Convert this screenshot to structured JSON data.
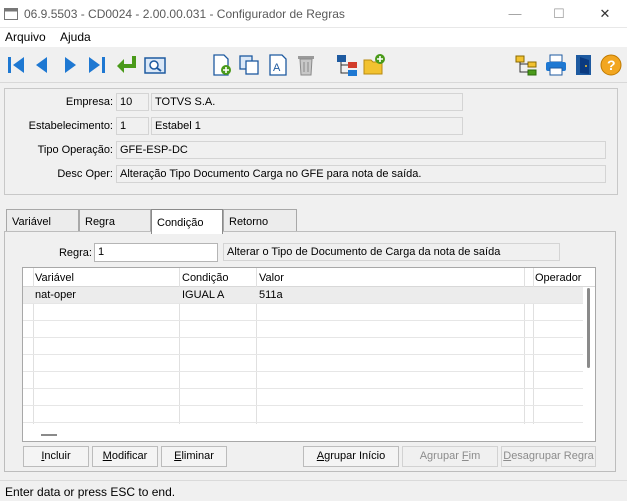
{
  "window": {
    "title": "06.9.5503 - CD0024 - 2.00.00.031 - Configurador de Regras",
    "controls": {
      "minimize": "—",
      "maximize": "☐",
      "close": "✕"
    }
  },
  "menu": [
    {
      "label": "Arquivo"
    },
    {
      "label": "Ajuda"
    }
  ],
  "toolbar": {
    "buttons": [
      "first-icon",
      "previous-icon",
      "next-icon",
      "last-icon",
      "goto-icon",
      "search-icon",
      "new-icon",
      "copy-icon",
      "edit-icon",
      "delete-icon",
      "tree-icon",
      "folder-new-icon",
      "hierarchy-icon",
      "print-icon",
      "exit-icon",
      "help-icon"
    ]
  },
  "header": {
    "empresa": {
      "label": "Empresa:",
      "code": "10",
      "name": "TOTVS S.A."
    },
    "estabelecimento": {
      "label": "Estabelecimento:",
      "code": "1",
      "name": "Estabel 1"
    },
    "tipo_operacao": {
      "label": "Tipo Operação:",
      "value": "GFE-ESP-DC"
    },
    "desc_oper": {
      "label": "Desc Oper:",
      "value": "Alteração Tipo Documento Carga no GFE para nota de saída."
    }
  },
  "tabs": [
    {
      "label": "Variável",
      "active": false
    },
    {
      "label": "Regra",
      "active": false
    },
    {
      "label": "Condição",
      "active": true
    },
    {
      "label": "Retorno",
      "active": false
    }
  ],
  "regra": {
    "label": "Regra:",
    "value": "1",
    "description": "Alterar o Tipo de Documento de Carga da nota de saída"
  },
  "grid": {
    "columns": [
      "Variável",
      "Condição",
      "Valor",
      "Operador"
    ],
    "rows": [
      {
        "variavel": "nat-oper",
        "condicao": "IGUAL A",
        "valor": "511a",
        "operador": ""
      }
    ]
  },
  "buttons": {
    "incluir": {
      "label": "Incluir",
      "underline": "I",
      "rest": "ncluir"
    },
    "modificar": {
      "label": "Modificar",
      "underline": "M",
      "rest": "odificar"
    },
    "eliminar": {
      "label": "Eliminar",
      "underline": "E",
      "rest": "liminar"
    },
    "agrupar_inicio": {
      "label": "Agrupar Início",
      "pre": "",
      "underline": "A",
      "rest": "grupar Início"
    },
    "agrupar_fim": {
      "label": "Agrupar Fim",
      "pre": "Agrupar ",
      "underline": "F",
      "rest": "im"
    },
    "desagrupar_regra": {
      "label": "Desagrupar Regra",
      "pre": "",
      "underline": "D",
      "rest": "esagrupar Regra"
    }
  },
  "status": {
    "text": "Enter data or press ESC to end."
  }
}
